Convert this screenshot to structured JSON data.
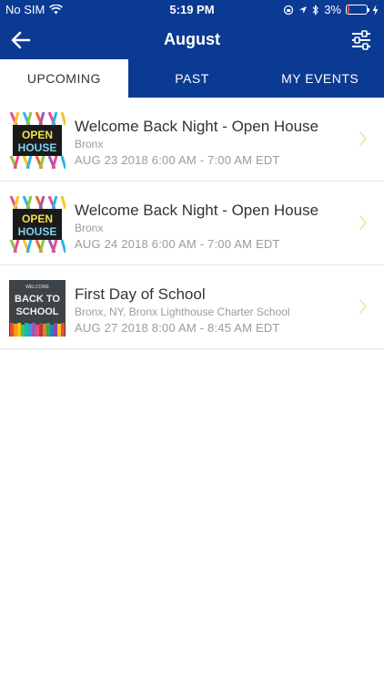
{
  "status_bar": {
    "carrier": "No SIM",
    "time": "5:19 PM",
    "battery": "3%"
  },
  "nav": {
    "title": "August"
  },
  "tabs": [
    {
      "label": "UPCOMING",
      "active": true
    },
    {
      "label": "PAST",
      "active": false
    },
    {
      "label": "MY EVENTS",
      "active": false
    }
  ],
  "events": [
    {
      "title": "Welcome Back Night - Open House",
      "location": "Bronx",
      "time": "AUG 23 2018 6:00 AM - 7:00 AM EDT",
      "thumb": "open-house-image"
    },
    {
      "title": "Welcome Back Night - Open House",
      "location": "Bronx",
      "time": "AUG 24 2018 6:00 AM - 7:00 AM EDT",
      "thumb": "open-house-image"
    },
    {
      "title": "First Day of School",
      "location": "Bronx, NY, Bronx Lighthouse Charter School",
      "time": "AUG 27 2018 8:00 AM - 8:45 AM EDT",
      "thumb": "back-to-school-image"
    }
  ],
  "thumb_text": {
    "open_house_line1": "OPEN",
    "open_house_line2": "HOUSE",
    "school_small": "WELCOME",
    "school_line1": "BACK TO",
    "school_line2": "SCHOOL"
  },
  "colors": {
    "header": "#0b3a93",
    "chevron": "#f3e7b0"
  }
}
